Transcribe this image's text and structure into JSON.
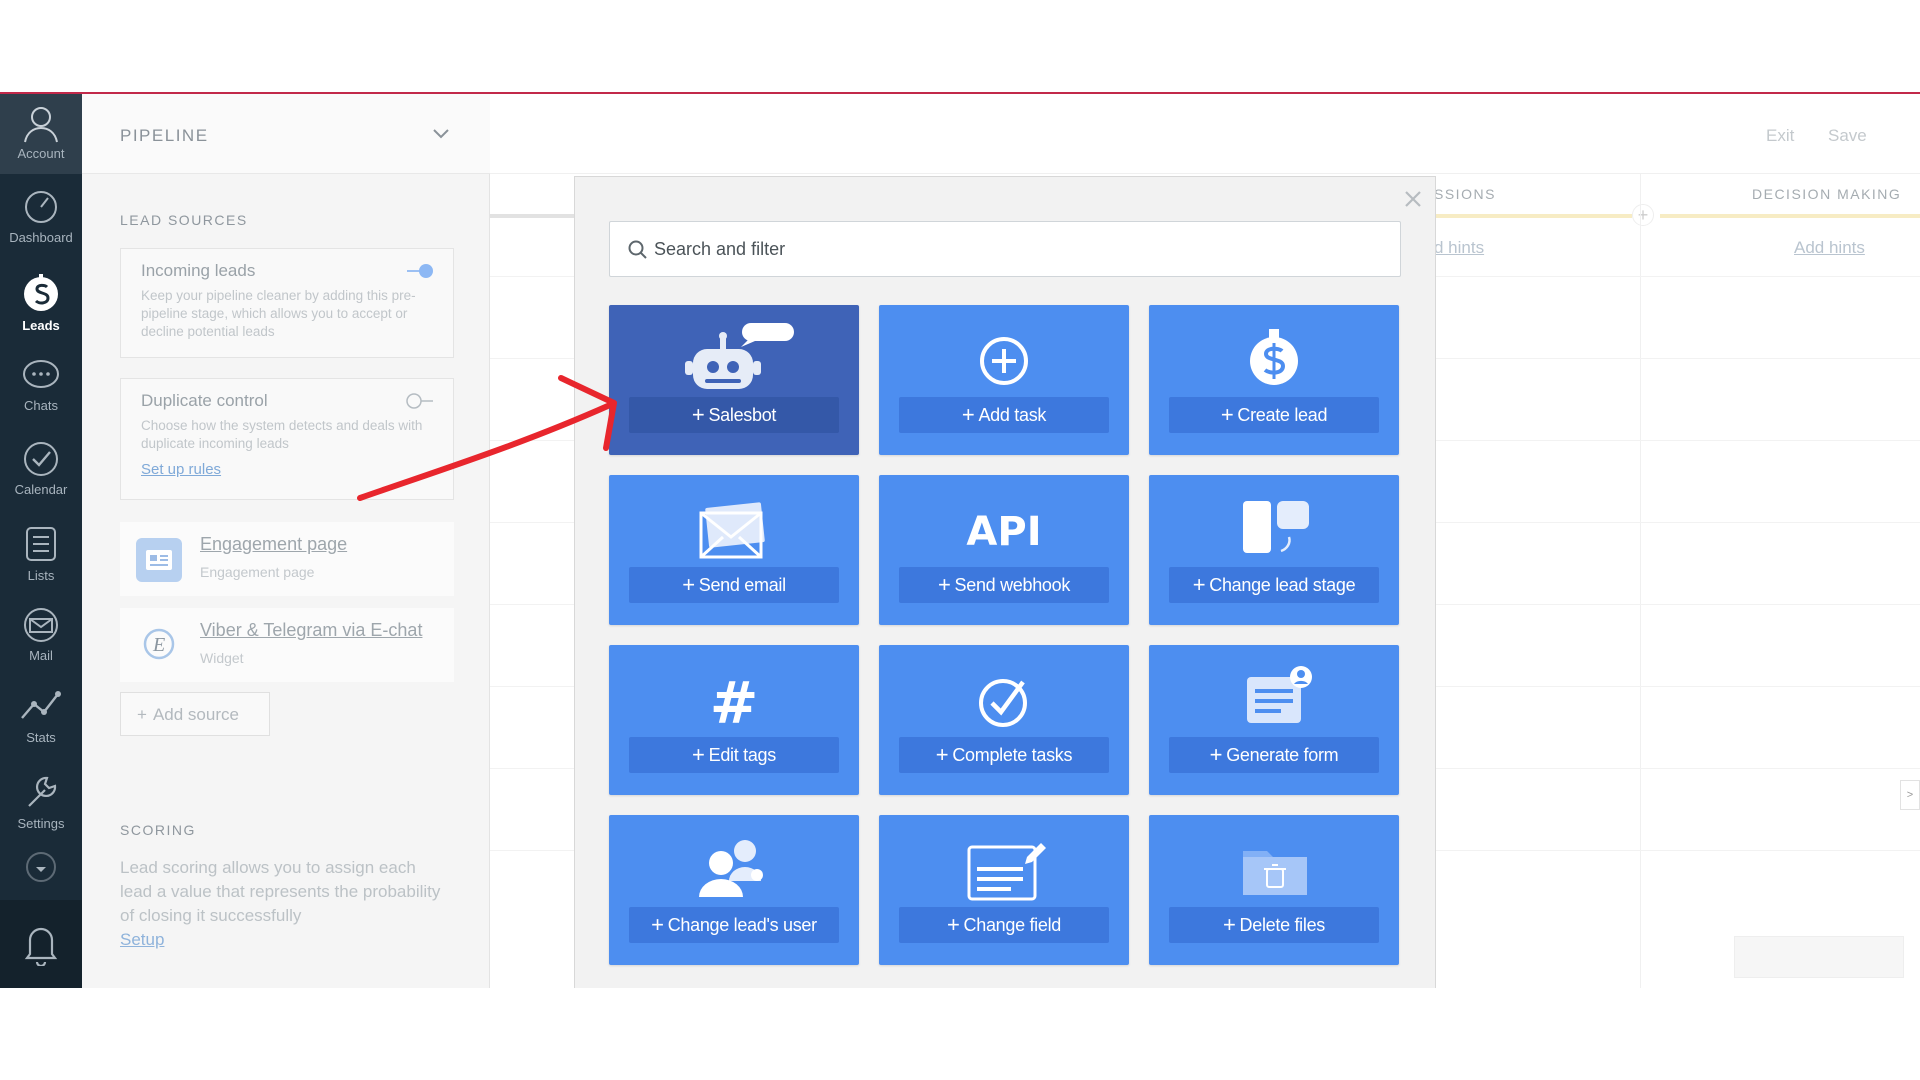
{
  "nav": {
    "items": [
      {
        "label": "Account",
        "icon": "account-icon"
      },
      {
        "label": "Dashboard",
        "icon": "dashboard-icon"
      },
      {
        "label": "Leads",
        "icon": "leads-icon",
        "active": true
      },
      {
        "label": "Chats",
        "icon": "chats-icon"
      },
      {
        "label": "Calendar",
        "icon": "calendar-icon"
      },
      {
        "label": "Lists",
        "icon": "lists-icon"
      },
      {
        "label": "Mail",
        "icon": "mail-icon"
      },
      {
        "label": "Stats",
        "icon": "stats-icon"
      },
      {
        "label": "Settings",
        "icon": "settings-icon"
      }
    ]
  },
  "panel": {
    "pipeline_title": "PIPELINE",
    "lead_sources_title": "LEAD SOURCES",
    "incoming": {
      "title": "Incoming leads",
      "desc": "Keep your pipeline cleaner by adding this pre-pipeline stage, which allows you to accept or decline potential leads",
      "enabled": true
    },
    "duplicate": {
      "title": "Duplicate control",
      "desc": "Choose how the system detects and deals with duplicate incoming leads",
      "link": "Set up rules",
      "enabled": false
    },
    "sources": [
      {
        "name": "Engagement page",
        "sub": "Engagement page"
      },
      {
        "name": "Viber & Telegram via E-chat",
        "sub": "Widget",
        "icon_text": "E"
      }
    ],
    "add_source": "Add source",
    "scoring_title": "SCORING",
    "scoring_desc": "Lead scoring allows you to assign each lead a value that represents the probability of closing it successfully",
    "scoring_link": "Setup"
  },
  "board": {
    "exit": "Exit",
    "save": "Save",
    "stages": [
      {
        "name": "SSIONS",
        "hint": "d hints"
      },
      {
        "name": "DECISION MAKING",
        "hint": "Add hints"
      }
    ]
  },
  "modal": {
    "search_placeholder": "Search and filter",
    "tiles": [
      {
        "label": "Salesbot",
        "icon": "robot-icon",
        "selected": true
      },
      {
        "label": "Add task",
        "icon": "plus-circle-icon"
      },
      {
        "label": "Create lead",
        "icon": "dollar-icon"
      },
      {
        "label": "Send email",
        "icon": "envelope-icon"
      },
      {
        "label": "Send webhook",
        "icon": "api-icon",
        "icon_text": "API"
      },
      {
        "label": "Change lead stage",
        "icon": "stage-icon"
      },
      {
        "label": "Edit tags",
        "icon": "hashtag-icon",
        "icon_text": "#"
      },
      {
        "label": "Complete tasks",
        "icon": "check-circle-icon"
      },
      {
        "label": "Generate form",
        "icon": "form-icon"
      },
      {
        "label": "Change lead's user",
        "icon": "users-icon"
      },
      {
        "label": "Change field",
        "icon": "field-edit-icon"
      },
      {
        "label": "Delete files",
        "icon": "folder-trash-icon"
      }
    ]
  },
  "colors": {
    "tile": "#4d8ef0",
    "tile_selected": "#3f63b7",
    "nav_bg": "#1a2b38",
    "annotation_arrow": "#e8262d"
  }
}
